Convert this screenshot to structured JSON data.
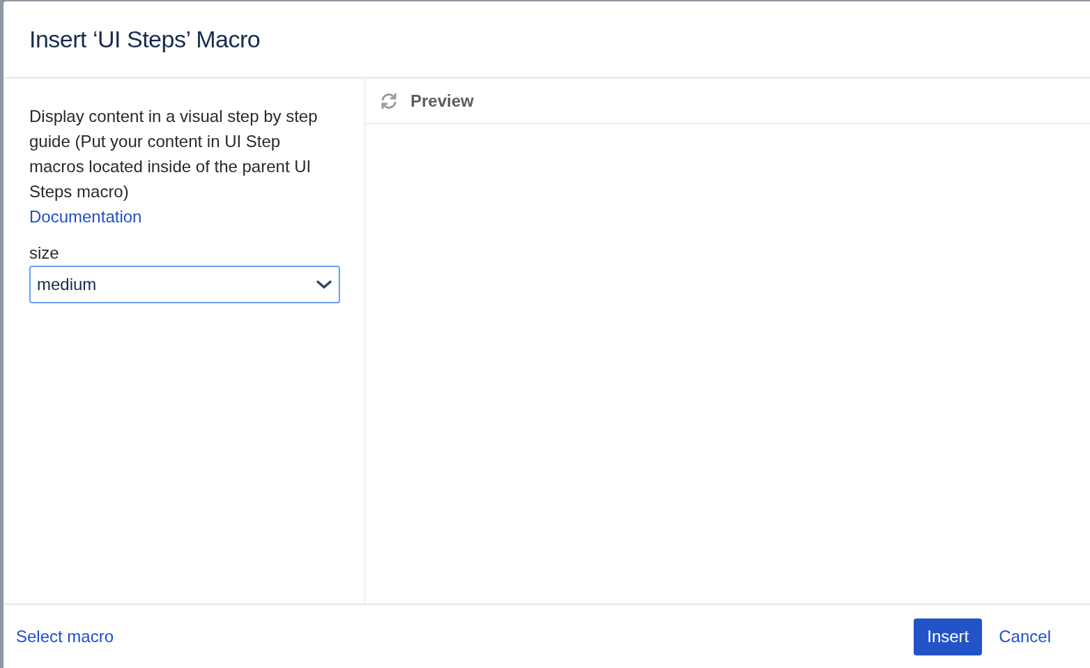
{
  "dialog": {
    "title": "Insert ‘UI Steps’ Macro"
  },
  "description": "Display content in a visual step by step guide (Put your content in UI Step macros located inside of the parent UI Steps macro)",
  "documentation_link": "Documentation",
  "fields": [
    {
      "label": "size",
      "value": "medium",
      "kind": "select",
      "focused": true
    }
  ],
  "preview": {
    "title": "Preview"
  },
  "footer": {
    "select_macro_link": "Select macro",
    "buttons": [
      {
        "label": "Insert",
        "kind": "primary"
      },
      {
        "label": "Cancel",
        "kind": "link"
      }
    ]
  }
}
